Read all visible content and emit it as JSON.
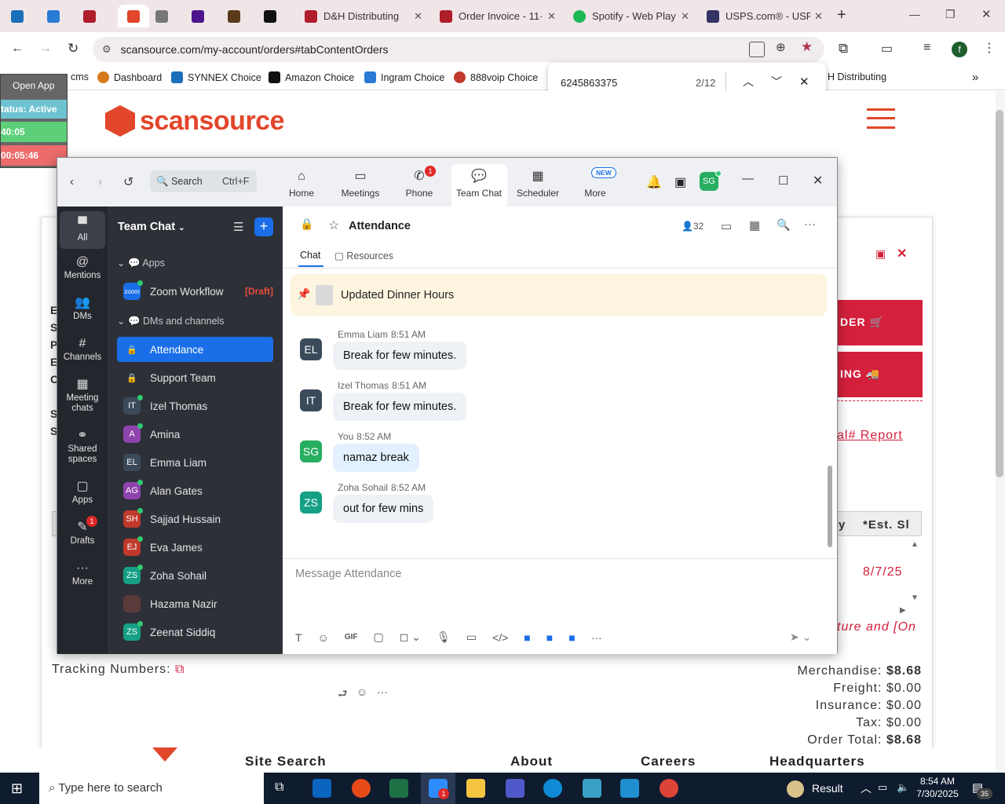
{
  "browser": {
    "tabs": [
      {
        "label": "",
        "active": false
      },
      {
        "label": "",
        "active": false
      },
      {
        "label": "",
        "active": false
      },
      {
        "label": "",
        "active": true
      },
      {
        "label": "",
        "active": false
      },
      {
        "label": "",
        "active": false
      },
      {
        "label": "",
        "active": false
      },
      {
        "label": "",
        "active": false
      },
      {
        "label": "D&H Distributing"
      },
      {
        "label": "Order Invoice - 11·"
      },
      {
        "label": "Spotify - Web Play"
      },
      {
        "label": "USPS.com® - USP"
      }
    ],
    "url": "scansource.com/my-account/orders#tabContentOrders",
    "bookmarks": [
      "cms",
      "Dashboard",
      "SYNNEX Choice",
      "Amazon Choice",
      "Ingram Choice",
      "888voip Choice",
      "H Distributing"
    ],
    "find": {
      "query": "6245863375",
      "count": "2/12"
    },
    "profile_initial": "f"
  },
  "overlay": {
    "open_app": "Open App",
    "status": "tatus: Active",
    "timer1": "40:05",
    "timer2": "00:05:46"
  },
  "site": {
    "logo": "scansource",
    "report_link": "al# Report",
    "order_btn": "DER",
    "tracking_btn": "ING",
    "table_header_qty": "y",
    "table_header_est": "*Est. Sl",
    "est_date": "8/7/25",
    "footer_link": "ture and [On",
    "tracking_label": "Tracking Numbers:",
    "totals": {
      "merch_label": "Merchandise:",
      "merch": "$8.68",
      "freight_label": "Freight:",
      "freight": "$0.00",
      "ins_label": "Insurance:",
      "ins": "$0.00",
      "tax_label": "Tax:",
      "tax": "$0.00",
      "total_label": "Order Total:",
      "total": "$8.68"
    },
    "footer": [
      "Site Search",
      "About",
      "Careers",
      "Headquarters"
    ],
    "left_letters": [
      "E",
      "S",
      "P",
      "E",
      "C",
      "S",
      "S"
    ]
  },
  "zoom": {
    "search_label": "Search",
    "search_shortcut": "Ctrl+F",
    "tabs": [
      {
        "label": "Home"
      },
      {
        "label": "Meetings"
      },
      {
        "label": "Phone",
        "badge": "1"
      },
      {
        "label": "Team Chat"
      },
      {
        "label": "Scheduler"
      },
      {
        "label": "More",
        "badge": "NEW"
      }
    ],
    "user_initials": "SG",
    "rail": [
      {
        "label": "All"
      },
      {
        "label": "Mentions"
      },
      {
        "label": "DMs"
      },
      {
        "label": "Channels"
      },
      {
        "label": "Meeting chats"
      },
      {
        "label": "Shared spaces"
      },
      {
        "label": "Apps"
      },
      {
        "label": "Drafts",
        "badge": "1"
      },
      {
        "label": "More"
      }
    ],
    "sidebar": {
      "title": "Team Chat",
      "section_apps": "Apps",
      "app_item": "Zoom Workflow",
      "draft_tag": "[Draft]",
      "section_dms": "DMs and channels",
      "channels": [
        {
          "name": "Attendance",
          "initials": "",
          "color": "#555"
        },
        {
          "name": "Support Team",
          "initials": "",
          "color": "#555"
        },
        {
          "name": "Izel Thomas",
          "initials": "IT",
          "color": "#3a4a5a"
        },
        {
          "name": "Amina",
          "initials": "A",
          "color": "#8e44ad"
        },
        {
          "name": "Emma Liam",
          "initials": "EL",
          "color": "#3a4a5a"
        },
        {
          "name": "Alan Gates",
          "initials": "AG",
          "color": "#8e44ad"
        },
        {
          "name": "Sajjad Hussain",
          "initials": "SH",
          "color": "#c0392b"
        },
        {
          "name": "Eva James",
          "initials": "EJ",
          "color": "#c0392b"
        },
        {
          "name": "Zoha Sohail",
          "initials": "ZS",
          "color": "#16a085"
        },
        {
          "name": "Hazama Nazir",
          "initials": "",
          "color": "#5a3a3a"
        },
        {
          "name": "Zeenat Siddiq",
          "initials": "ZS",
          "color": "#16a085"
        }
      ]
    },
    "chat": {
      "channel": "Attendance",
      "member_count": "32",
      "tab_chat": "Chat",
      "tab_resources": "Resources",
      "pinned": "Updated Dinner Hours",
      "messages": [
        {
          "name": "Emma Liam",
          "time": "8:51 AM",
          "initials": "EL",
          "color": "#3a4a5a",
          "text": "Break for few minutes."
        },
        {
          "name": "Izel Thomas",
          "time": "8:51 AM",
          "initials": "IT",
          "color": "#3a4a5a",
          "text": "Break for few minutes."
        },
        {
          "name": "You",
          "time": "8:52 AM",
          "initials": "SG",
          "color": "#27ae60",
          "text": "namaz break"
        },
        {
          "name": "Zoha Sohail",
          "time": "8:52 AM",
          "initials": "ZS",
          "color": "#16a085",
          "text": "out for few mins"
        }
      ],
      "composer_placeholder": "Message Attendance"
    }
  },
  "taskbar": {
    "search_placeholder": "Type here to search",
    "weather": "Result",
    "time": "8:54 AM",
    "date": "7/30/2025",
    "notif_count": "35",
    "zoom_badge": "1"
  }
}
